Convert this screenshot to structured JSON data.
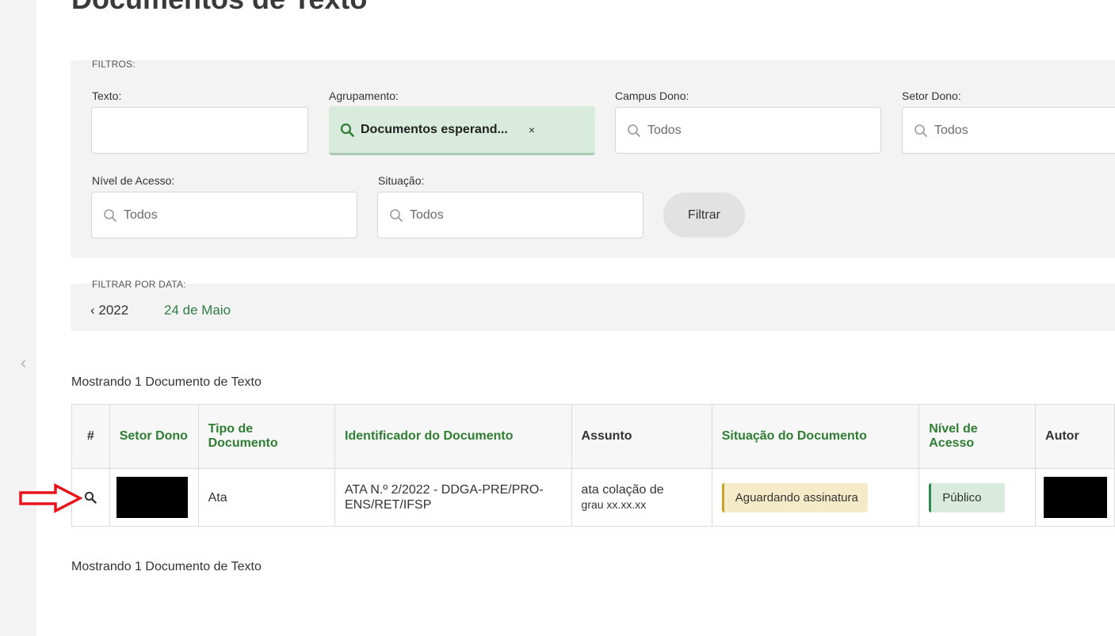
{
  "page": {
    "title": "Documentos de Texto"
  },
  "filters": {
    "caption": "FILTROS:",
    "texto": {
      "label": "Texto:",
      "value": ""
    },
    "agrupamento": {
      "label": "Agrupamento:",
      "value": "Documentos esperand...",
      "remove": "×"
    },
    "campus_dono": {
      "label": "Campus Dono:",
      "placeholder": "Todos"
    },
    "setor_dono": {
      "label": "Setor Dono:",
      "placeholder": "Todos"
    },
    "nivel_acesso": {
      "label": "Nível de Acesso:",
      "placeholder": "Todos"
    },
    "situacao": {
      "label": "Situação:",
      "placeholder": "Todos"
    },
    "submit_label": "Filtrar"
  },
  "date_filter": {
    "caption": "FILTRAR POR DATA:",
    "prev": "‹ 2022",
    "current": "24 de Maio"
  },
  "results": {
    "count_label": "Mostrando 1 Documento de Texto"
  },
  "table": {
    "headers": {
      "hash": "#",
      "setor_dono": "Setor Dono",
      "tipo": "Tipo de Documento",
      "identificador": "Identificador do Documento",
      "assunto": "Assunto",
      "situacao": "Situação do Documento",
      "nivel": "Nível de Acesso",
      "autor": "Autor"
    },
    "rows": [
      {
        "tipo": "Ata",
        "identificador": "ATA N.º 2/2022 - DDGA-PRE/PRO-ENS/RET/IFSP",
        "assunto_line1": "ata colação de",
        "assunto_line2": "grau xx.xx.xx",
        "situacao": "Aguardando assinatura",
        "nivel": "Público"
      }
    ]
  },
  "icons": {
    "search": "magnifier-icon",
    "collapse": "chevron-left-icon",
    "annotation": "red-arrow-icon"
  },
  "colors": {
    "accent_green": "#2e7d32",
    "chip_green": "#d8ebdc",
    "status_yellow": "#f5ebc8",
    "arrow_red": "#e8141c"
  }
}
